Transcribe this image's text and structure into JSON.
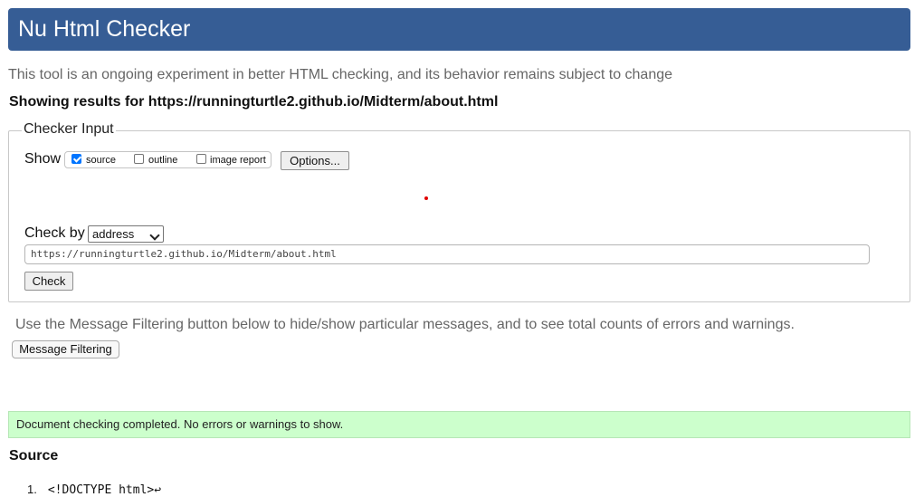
{
  "header": {
    "title": "Nu Html Checker"
  },
  "intro": "This tool is an ongoing experiment in better HTML checking, and its behavior remains subject to change",
  "results_for": "Showing results for https://runningturtle2.github.io/Midterm/about.html",
  "checker_input": {
    "legend": "Checker Input",
    "show_label": "Show",
    "show_options": [
      {
        "label": "source",
        "checked": true
      },
      {
        "label": "outline",
        "checked": false
      },
      {
        "label": "image report",
        "checked": false
      }
    ],
    "options_button": "Options...",
    "check_by_label": "Check by",
    "check_by_value": "address",
    "url_value": "https://runningturtle2.github.io/Midterm/about.html",
    "check_button": "Check"
  },
  "filtering": {
    "text": "Use the Message Filtering button below to hide/show particular messages, and to see total counts of errors and warnings.",
    "button": "Message Filtering"
  },
  "status": {
    "message": "Document checking completed. No errors or warnings to show.",
    "color": "#ccffcc"
  },
  "source": {
    "heading": "Source",
    "lines": [
      {
        "number": "1.",
        "code": "<!DOCTYPE html>↩"
      }
    ]
  },
  "colors": {
    "header_bg": "#365d95",
    "success_bg": "#ccffcc"
  }
}
